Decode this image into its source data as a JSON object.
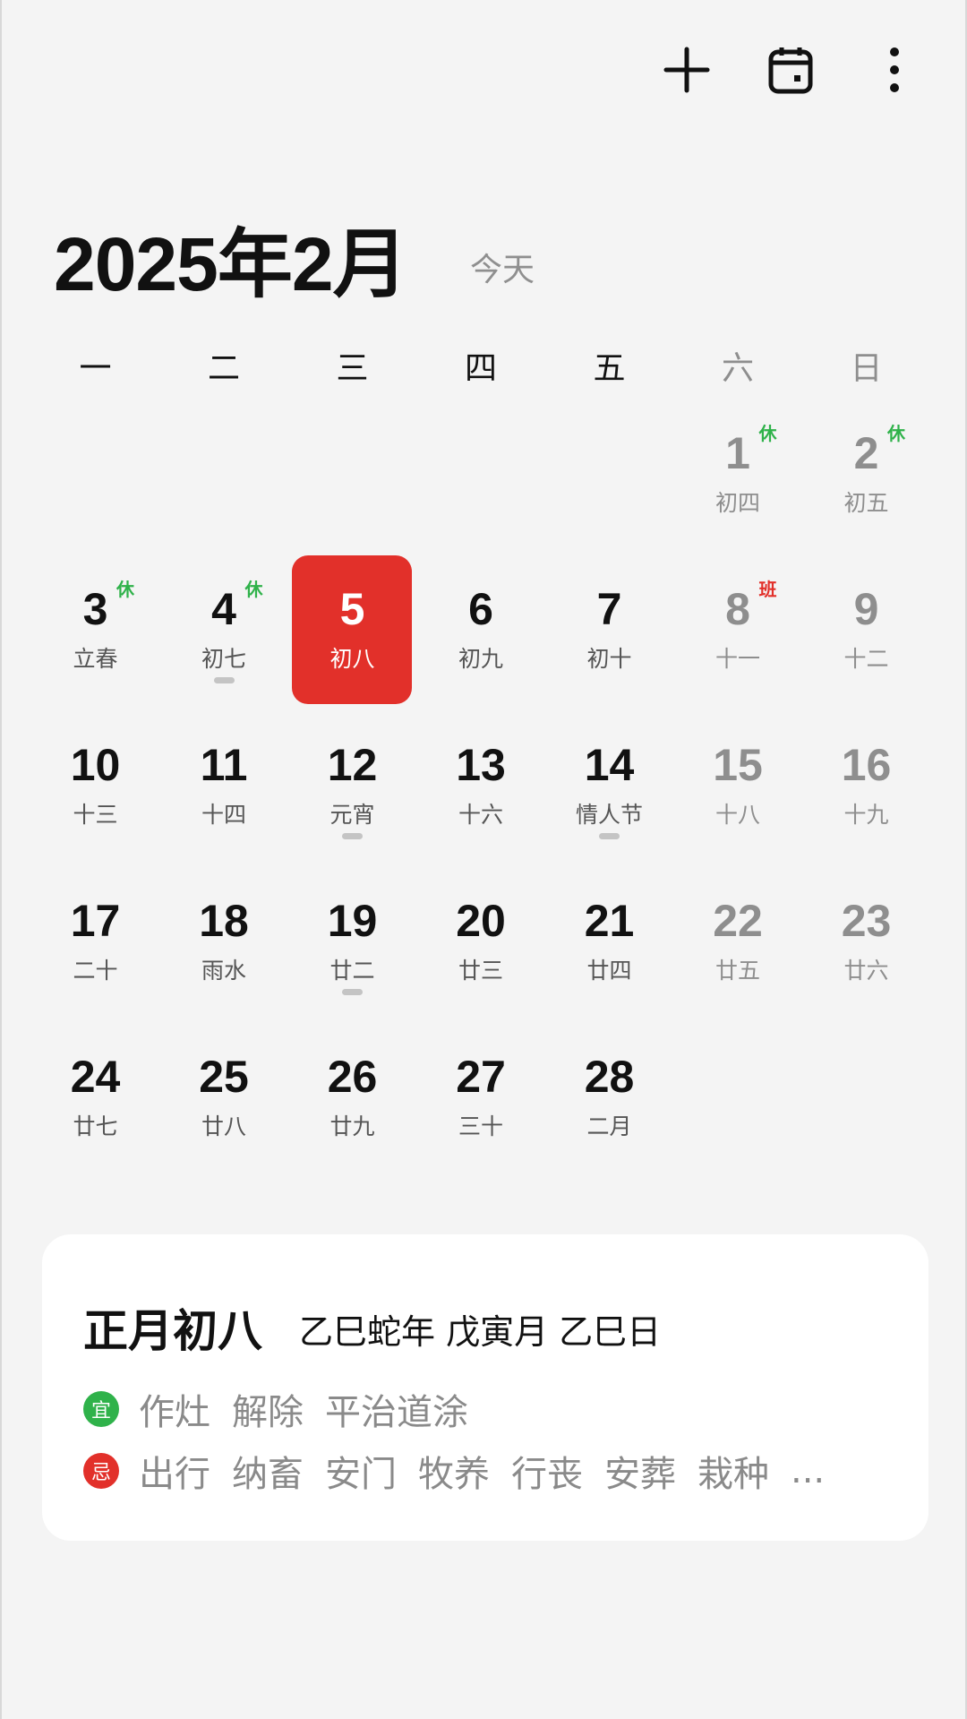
{
  "toolbar": {
    "add_icon": "plus-icon",
    "calendar_icon": "calendar-icon",
    "more_icon": "more-vertical-icon"
  },
  "header": {
    "title": "2025年2月",
    "today_label": "今天"
  },
  "weekdays": [
    "一",
    "二",
    "三",
    "四",
    "五",
    "六",
    "日"
  ],
  "colors": {
    "today": "#e2302a",
    "holiday_rest": "#2fb24a",
    "workday": "#e2302a",
    "weekend_text": "#8e8e8e"
  },
  "days": [
    {
      "d": "1",
      "l": "初四",
      "col": 5,
      "row": 0,
      "badge": "休"
    },
    {
      "d": "2",
      "l": "初五",
      "col": 6,
      "row": 0,
      "badge": "休"
    },
    {
      "d": "3",
      "l": "立春",
      "col": 0,
      "row": 1,
      "badge": "休"
    },
    {
      "d": "4",
      "l": "初七",
      "col": 1,
      "row": 1,
      "badge": "休",
      "event": true
    },
    {
      "d": "5",
      "l": "初八",
      "col": 2,
      "row": 1,
      "selected": true
    },
    {
      "d": "6",
      "l": "初九",
      "col": 3,
      "row": 1
    },
    {
      "d": "7",
      "l": "初十",
      "col": 4,
      "row": 1
    },
    {
      "d": "8",
      "l": "十一",
      "col": 5,
      "row": 1,
      "badge": "班"
    },
    {
      "d": "9",
      "l": "十二",
      "col": 6,
      "row": 1
    },
    {
      "d": "10",
      "l": "十三",
      "col": 0,
      "row": 2
    },
    {
      "d": "11",
      "l": "十四",
      "col": 1,
      "row": 2
    },
    {
      "d": "12",
      "l": "元宵",
      "col": 2,
      "row": 2,
      "event": true
    },
    {
      "d": "13",
      "l": "十六",
      "col": 3,
      "row": 2
    },
    {
      "d": "14",
      "l": "情人节",
      "col": 4,
      "row": 2,
      "event": true
    },
    {
      "d": "15",
      "l": "十八",
      "col": 5,
      "row": 2
    },
    {
      "d": "16",
      "l": "十九",
      "col": 6,
      "row": 2
    },
    {
      "d": "17",
      "l": "二十",
      "col": 0,
      "row": 3
    },
    {
      "d": "18",
      "l": "雨水",
      "col": 1,
      "row": 3
    },
    {
      "d": "19",
      "l": "廿二",
      "col": 2,
      "row": 3,
      "event": true
    },
    {
      "d": "20",
      "l": "廿三",
      "col": 3,
      "row": 3
    },
    {
      "d": "21",
      "l": "廿四",
      "col": 4,
      "row": 3
    },
    {
      "d": "22",
      "l": "廿五",
      "col": 5,
      "row": 3
    },
    {
      "d": "23",
      "l": "廿六",
      "col": 6,
      "row": 3
    },
    {
      "d": "24",
      "l": "廿七",
      "col": 0,
      "row": 4
    },
    {
      "d": "25",
      "l": "廿八",
      "col": 1,
      "row": 4
    },
    {
      "d": "26",
      "l": "廿九",
      "col": 2,
      "row": 4
    },
    {
      "d": "27",
      "l": "三十",
      "col": 3,
      "row": 4
    },
    {
      "d": "28",
      "l": "二月",
      "col": 4,
      "row": 4
    }
  ],
  "card": {
    "lunar_date": "正月初八",
    "ganzhi": "乙巳蛇年 戊寅月 乙巳日",
    "yi_label": "宜",
    "yi": [
      "作灶",
      "解除",
      "平治道涂"
    ],
    "ji_label": "忌",
    "ji": [
      "出行",
      "纳畜",
      "安门",
      "牧养",
      "行丧",
      "安葬",
      "栽种",
      "..."
    ]
  }
}
